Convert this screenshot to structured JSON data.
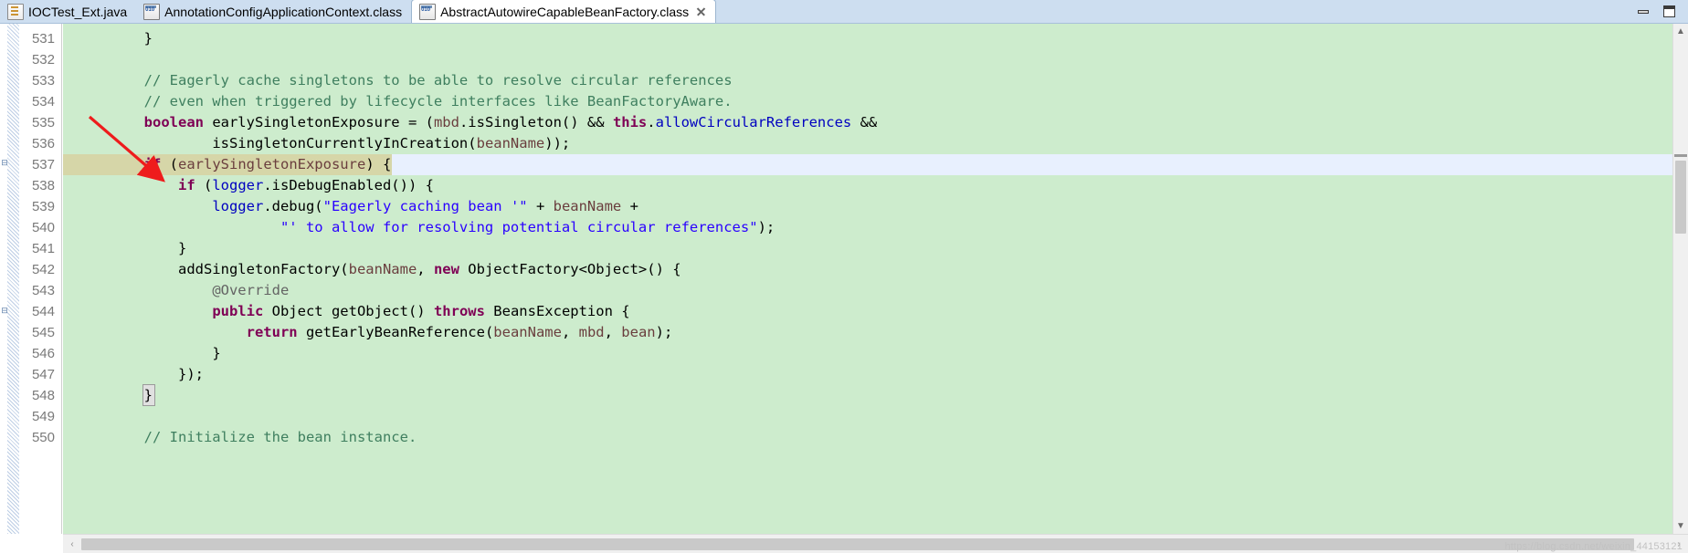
{
  "window": {
    "minimize_label": "Minimize",
    "maximize_label": "Maximize"
  },
  "tabs": [
    {
      "label": "IOCTest_Ext.java",
      "icon": "java-file-icon",
      "active": false,
      "closable": false
    },
    {
      "label": "AnnotationConfigApplicationContext.class",
      "icon": "class-file-icon",
      "active": false,
      "closable": false
    },
    {
      "label": "AbstractAutowireCapableBeanFactory.class",
      "icon": "class-file-icon",
      "active": true,
      "closable": true
    }
  ],
  "editor": {
    "first_line": 531,
    "current_line": 537,
    "lines": [
      {
        "n": 531,
        "indent": 8,
        "tokens": [
          {
            "t": "}",
            "c": "pl"
          }
        ]
      },
      {
        "n": 532,
        "indent": 0,
        "tokens": []
      },
      {
        "n": 533,
        "indent": 8,
        "tokens": [
          {
            "t": "// Eagerly cache singletons to be able to resolve circular references",
            "c": "cm"
          }
        ]
      },
      {
        "n": 534,
        "indent": 8,
        "tokens": [
          {
            "t": "// even when triggered by lifecycle interfaces like BeanFactoryAware.",
            "c": "cm"
          }
        ]
      },
      {
        "n": 535,
        "indent": 8,
        "tokens": [
          {
            "t": "boolean",
            "c": "k"
          },
          {
            "t": " earlySingletonExposure = (",
            "c": "pl"
          },
          {
            "t": "mbd",
            "c": "pm"
          },
          {
            "t": ".isSingleton() && ",
            "c": "pl"
          },
          {
            "t": "this",
            "c": "k"
          },
          {
            "t": ".",
            "c": "pl"
          },
          {
            "t": "allowCircularReferences",
            "c": "fl"
          },
          {
            "t": " &&",
            "c": "pl"
          }
        ]
      },
      {
        "n": 536,
        "indent": 16,
        "tokens": [
          {
            "t": "isSingletonCurrentlyInCreation(",
            "c": "pl"
          },
          {
            "t": "beanName",
            "c": "pm"
          },
          {
            "t": "));",
            "c": "pl"
          }
        ]
      },
      {
        "n": 537,
        "indent": 8,
        "tokens": [
          {
            "t": "if",
            "c": "k"
          },
          {
            "t": " (",
            "c": "pl"
          },
          {
            "t": "earlySingletonExposure",
            "c": "pm"
          },
          {
            "t": ") {",
            "c": "pl"
          }
        ]
      },
      {
        "n": 538,
        "indent": 12,
        "tokens": [
          {
            "t": "if",
            "c": "k"
          },
          {
            "t": " (",
            "c": "pl"
          },
          {
            "t": "logger",
            "c": "fl"
          },
          {
            "t": ".isDebugEnabled()) {",
            "c": "pl"
          }
        ]
      },
      {
        "n": 539,
        "indent": 16,
        "tokens": [
          {
            "t": "logger",
            "c": "fl"
          },
          {
            "t": ".debug(",
            "c": "pl"
          },
          {
            "t": "\"Eagerly caching bean '\"",
            "c": "st"
          },
          {
            "t": " + ",
            "c": "pl"
          },
          {
            "t": "beanName",
            "c": "pm"
          },
          {
            "t": " +",
            "c": "pl"
          }
        ]
      },
      {
        "n": 540,
        "indent": 24,
        "tokens": [
          {
            "t": "\"' to allow for resolving potential circular references\"",
            "c": "st"
          },
          {
            "t": ");",
            "c": "pl"
          }
        ]
      },
      {
        "n": 541,
        "indent": 12,
        "tokens": [
          {
            "t": "}",
            "c": "pl"
          }
        ]
      },
      {
        "n": 542,
        "indent": 12,
        "tokens": [
          {
            "t": "addSingletonFactory(",
            "c": "pl"
          },
          {
            "t": "beanName",
            "c": "pm"
          },
          {
            "t": ", ",
            "c": "pl"
          },
          {
            "t": "new",
            "c": "k"
          },
          {
            "t": " ObjectFactory<Object>() {",
            "c": "pl"
          }
        ]
      },
      {
        "n": 543,
        "indent": 16,
        "tokens": [
          {
            "t": "@Override",
            "c": "an"
          }
        ]
      },
      {
        "n": 544,
        "indent": 16,
        "tokens": [
          {
            "t": "public",
            "c": "k"
          },
          {
            "t": " Object getObject() ",
            "c": "pl"
          },
          {
            "t": "throws",
            "c": "k"
          },
          {
            "t": " BeansException {",
            "c": "pl"
          }
        ]
      },
      {
        "n": 545,
        "indent": 20,
        "tokens": [
          {
            "t": "return",
            "c": "k"
          },
          {
            "t": " getEarlyBeanReference(",
            "c": "pl"
          },
          {
            "t": "beanName",
            "c": "pm"
          },
          {
            "t": ", ",
            "c": "pl"
          },
          {
            "t": "mbd",
            "c": "pm"
          },
          {
            "t": ", ",
            "c": "pl"
          },
          {
            "t": "bean",
            "c": "pm"
          },
          {
            "t": ");",
            "c": "pl"
          }
        ]
      },
      {
        "n": 546,
        "indent": 16,
        "tokens": [
          {
            "t": "}",
            "c": "pl"
          }
        ]
      },
      {
        "n": 547,
        "indent": 12,
        "tokens": [
          {
            "t": "});",
            "c": "pl"
          }
        ]
      },
      {
        "n": 548,
        "indent": 8,
        "tokens": [
          {
            "t": "}",
            "c": "pl"
          }
        ]
      },
      {
        "n": 549,
        "indent": 0,
        "tokens": []
      },
      {
        "n": 550,
        "indent": 8,
        "tokens": [
          {
            "t": "// Initialize the bean instance.",
            "c": "cm"
          }
        ]
      }
    ],
    "colors": {
      "background": "#cdeccd",
      "current_line_highlight": "#e8f0fe",
      "selection": "#d6d6a8",
      "keyword": "#7f0055",
      "comment": "#3f7f5f",
      "string": "#2a00ff",
      "field": "#0000c0",
      "parameter": "#6a3e3e",
      "annotation": "#646464",
      "line_number": "#7a7a7a"
    }
  },
  "annotation": {
    "arrow_color": "#ee1c1c",
    "arrow_points_to_line": 537
  },
  "scrollbars": {
    "vertical_up": "▲",
    "vertical_down": "▼",
    "horizontal_left": "‹",
    "horizontal_right": "›"
  },
  "watermark": {
    "text": "https://blog.csdn.net/weixin_44153121"
  }
}
